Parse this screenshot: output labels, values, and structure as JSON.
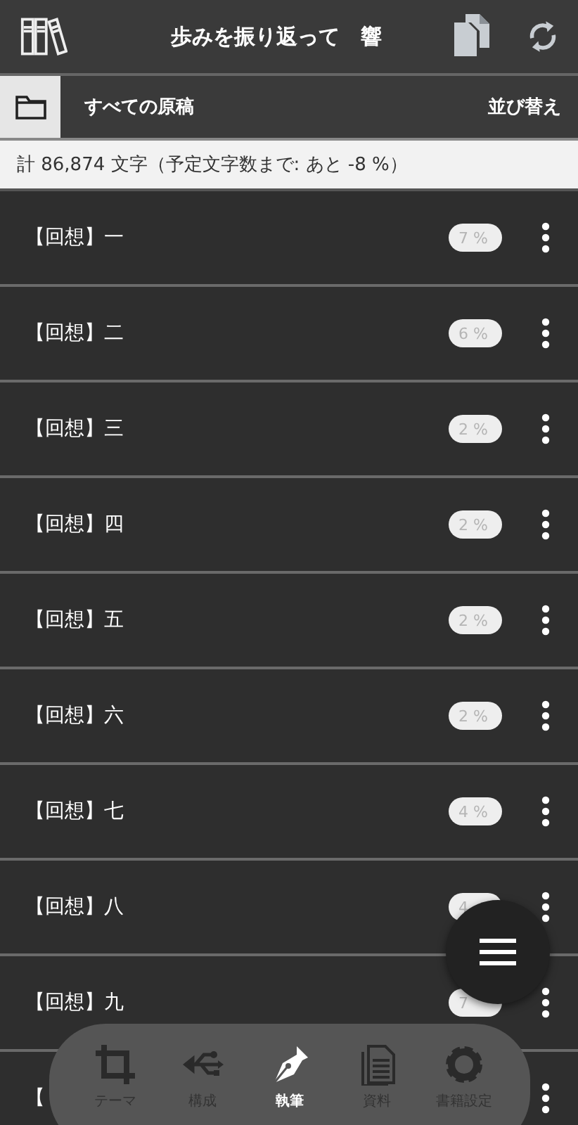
{
  "header": {
    "title": "歩みを振り返って　響"
  },
  "folder_bar": {
    "label": "すべての原稿",
    "sort": "並び替え"
  },
  "summary": "計 86,874 文字（予定文字数まで: あと -8 %）",
  "manuscripts": [
    {
      "title": "【回想】一",
      "percent": "7 %"
    },
    {
      "title": "【回想】二",
      "percent": "6 %"
    },
    {
      "title": "【回想】三",
      "percent": "2 %"
    },
    {
      "title": "【回想】四",
      "percent": "2 %"
    },
    {
      "title": "【回想】五",
      "percent": "2 %"
    },
    {
      "title": "【回想】六",
      "percent": "2 %"
    },
    {
      "title": "【回想】七",
      "percent": "4 %"
    },
    {
      "title": "【回想】八",
      "percent": "4"
    },
    {
      "title": "【回想】九",
      "percent": "7"
    },
    {
      "title": "【"
    }
  ],
  "nav": [
    {
      "kind": "crop",
      "label": "テーマ",
      "selected": false
    },
    {
      "kind": "usb",
      "label": "構成",
      "selected": false
    },
    {
      "kind": "pen",
      "label": "執筆",
      "selected": true
    },
    {
      "kind": "document",
      "label": "資料",
      "selected": false
    },
    {
      "kind": "gear",
      "label": "書籍設定",
      "selected": false
    }
  ]
}
